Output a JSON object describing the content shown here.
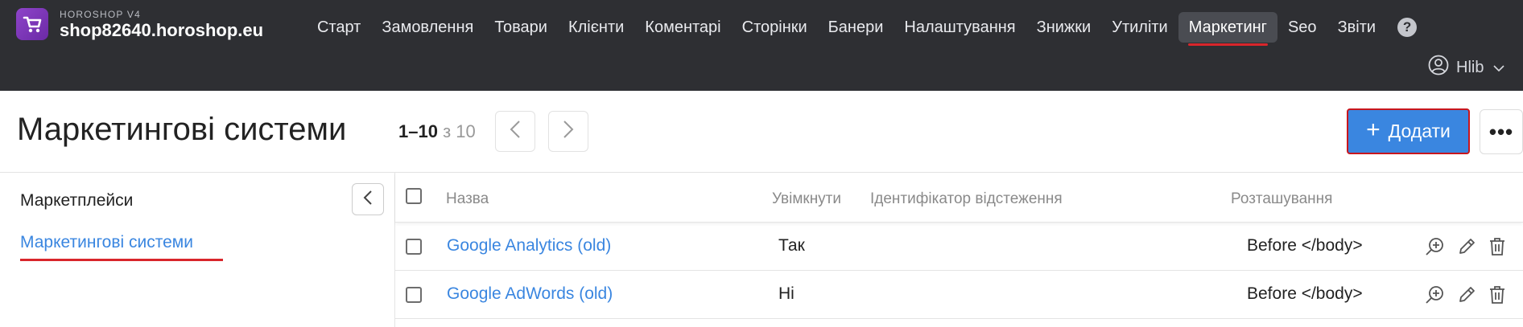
{
  "header": {
    "brand_small": "HOROSHOP V4",
    "domain": "shop82640.horoshop.eu",
    "nav": [
      {
        "label": "Старт"
      },
      {
        "label": "Замовлення"
      },
      {
        "label": "Товари"
      },
      {
        "label": "Клієнти"
      },
      {
        "label": "Коментарі"
      },
      {
        "label": "Сторінки"
      },
      {
        "label": "Банери"
      },
      {
        "label": "Налаштування"
      },
      {
        "label": "Знижки"
      },
      {
        "label": "Утиліти"
      },
      {
        "label": "Маркетинг",
        "active": true
      },
      {
        "label": "Seo"
      },
      {
        "label": "Звіти"
      }
    ],
    "help_label": "?",
    "user_name": "Hlib"
  },
  "page": {
    "title": "Маркетингові системи",
    "pager_range": "1–10",
    "pager_of": " з 10",
    "add_label": "Додати",
    "more_label": "•••"
  },
  "sidebar": {
    "items": [
      {
        "label": "Маркетплейси"
      },
      {
        "label": "Маркетингові системи",
        "active": true
      }
    ]
  },
  "table": {
    "columns": {
      "name": "Назва",
      "enabled": "Увімкнути",
      "tracking_id": "Ідентифікатор відстеження",
      "placement": "Розташування"
    },
    "rows": [
      {
        "name": "Google Analytics (old)",
        "enabled": "Так",
        "tracking_id": "",
        "placement": "Before </body>"
      },
      {
        "name": "Google AdWords (old)",
        "enabled": "Ні",
        "tracking_id": "",
        "placement": "Before </body>"
      }
    ]
  },
  "colors": {
    "topbar_bg": "#2e2f33",
    "accent_blue": "#3a86e0",
    "accent_red": "#d9262c",
    "brand_purple": "#7b35b8"
  },
  "icons": [
    "cart-logo-icon",
    "help-icon",
    "user-avatar-icon",
    "chevron-down-icon",
    "chevron-left-icon",
    "chevron-right-icon",
    "plus-icon",
    "zoom-in-icon",
    "pencil-icon",
    "trash-icon"
  ]
}
